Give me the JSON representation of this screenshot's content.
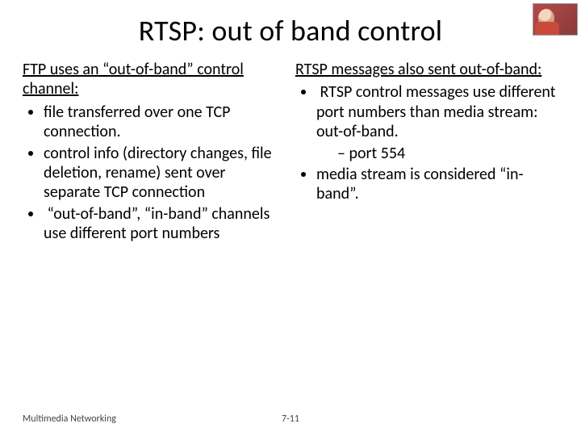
{
  "title": "RTSP: out of band control",
  "left": {
    "heading": "FTP uses an “out-of-band” control channel:",
    "bullets": [
      "file transferred over one TCP connection.",
      "control info (directory changes, file deletion, rename) sent over separate TCP connection",
      " “out-of-band”, “in-band” channels use different port numbers"
    ]
  },
  "right": {
    "heading": "RTSP messages also sent out-of-band:",
    "bullet1": " RTSP control messages use different port numbers than media stream: out-of-band.",
    "sub1": "port 554",
    "bullet2": "media stream is considered “in-band”."
  },
  "footer": {
    "left": "Multimedia Networking",
    "center": "7-11"
  },
  "corner_image_name": "host-photo"
}
